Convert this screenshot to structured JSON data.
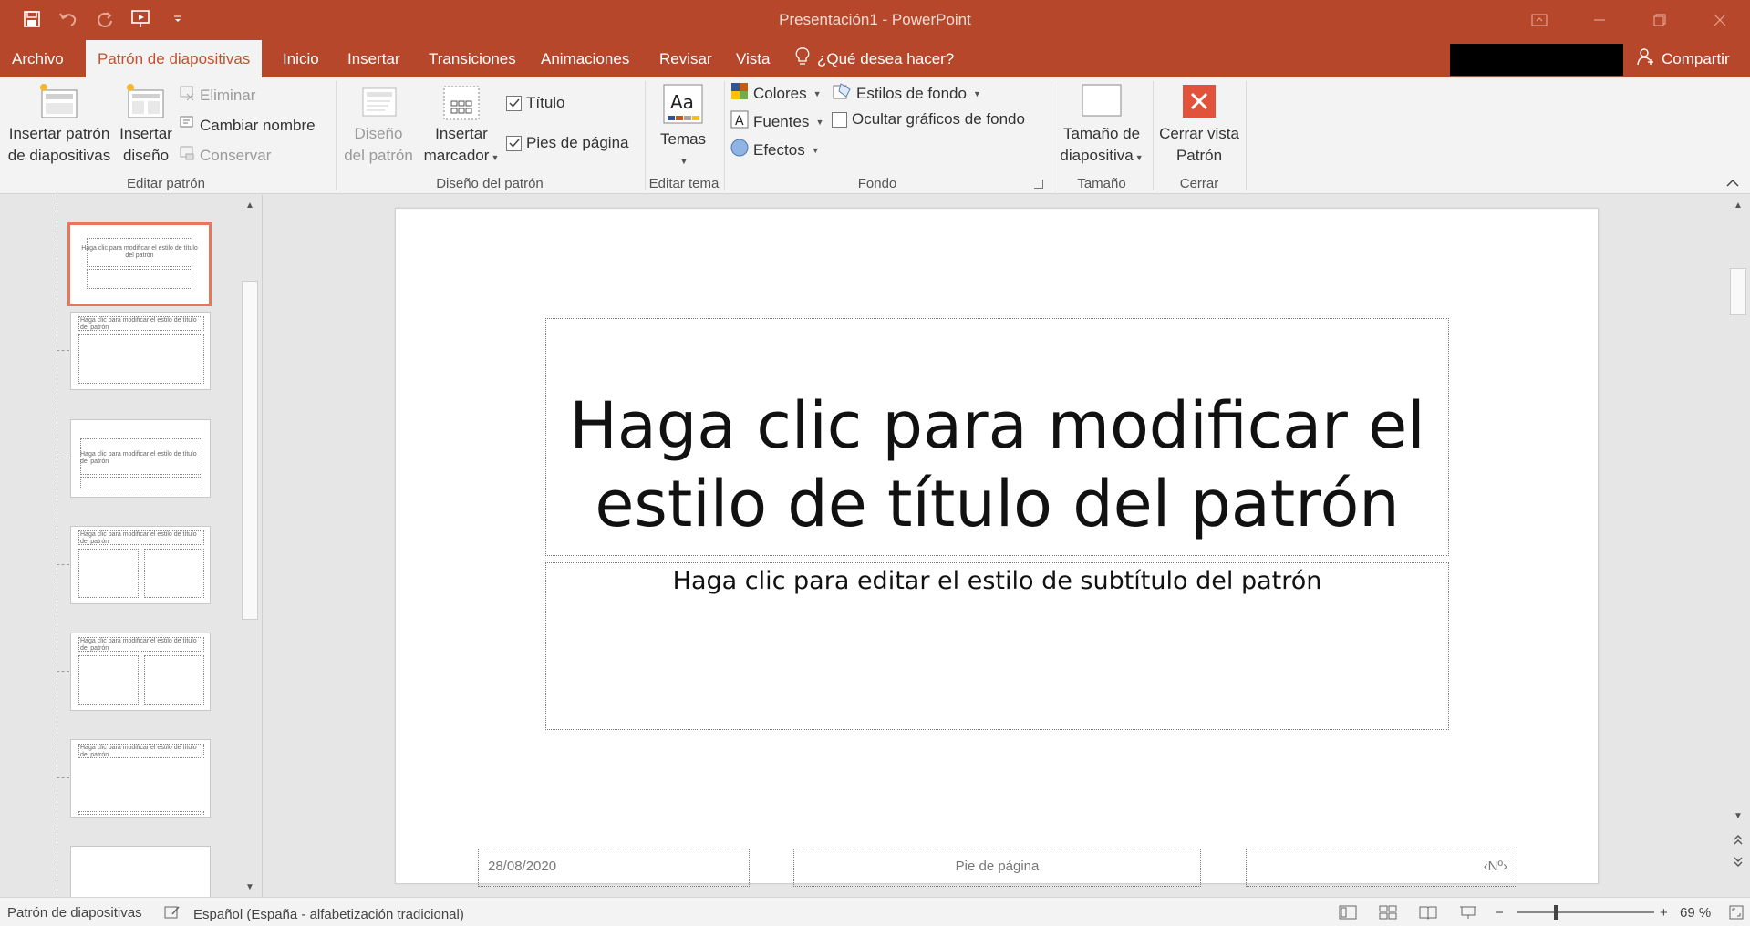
{
  "window": {
    "title": "Presentación1 - PowerPoint"
  },
  "quick_access": {
    "save_icon": "save-icon",
    "undo_icon": "undo-icon",
    "redo_icon": "redo-icon",
    "present_icon": "start-from-beginning-icon",
    "customize_icon": "customize-qat-icon"
  },
  "tabs": [
    {
      "label": "Archivo"
    },
    {
      "label": "Patrón de diapositivas",
      "active": true
    },
    {
      "label": "Inicio"
    },
    {
      "label": "Insertar"
    },
    {
      "label": "Transiciones"
    },
    {
      "label": "Animaciones"
    },
    {
      "label": "Revisar"
    },
    {
      "label": "Vista"
    }
  ],
  "tell_me": "¿Qué desea hacer?",
  "share_label": "Compartir",
  "ribbon": {
    "editar_patron": {
      "label": "Editar patrón",
      "insert_master": [
        "Insertar patrón",
        "de diapositivas"
      ],
      "insert_layout": [
        "Insertar",
        "diseño"
      ],
      "delete": "Eliminar",
      "rename": "Cambiar nombre",
      "preserve": "Conservar"
    },
    "diseno_patron": {
      "label": "Diseño del patrón",
      "master_layout": [
        "Diseño",
        "del patrón"
      ],
      "insert_placeholder": [
        "Insertar",
        "marcador"
      ],
      "title_check": "Título",
      "footers_check": "Pies de página"
    },
    "editar_tema": {
      "label": "Editar tema",
      "themes": "Temas"
    },
    "fondo": {
      "label": "Fondo",
      "colors": "Colores",
      "fonts": "Fuentes",
      "effects": "Efectos",
      "bg_styles": "Estilos de fondo",
      "hide_bg": "Ocultar gráficos de fondo"
    },
    "tamano": {
      "label": "Tamaño",
      "slide_size": [
        "Tamaño de",
        "diapositiva"
      ]
    },
    "cerrar": {
      "label": "Cerrar",
      "close_master": [
        "Cerrar vista",
        "Patrón"
      ]
    }
  },
  "thumbnails": [
    {
      "text": "Haga clic para modificar el estilo de título del patrón",
      "selected": true
    },
    {
      "text": "Haga clic para modificar el estilo de título del patrón"
    },
    {
      "text": "Haga clic para modificar el estilo de título del patrón"
    },
    {
      "text": "Haga clic para modificar el estilo de título del patrón"
    },
    {
      "text": "Haga clic para modificar el estilo de título del patrón"
    },
    {
      "text": "Haga clic para modificar el estilo de título del patrón"
    },
    {
      "text": ""
    }
  ],
  "slide": {
    "title_line1": "Haga clic para modificar el",
    "title_line2": "estilo de título del patrón",
    "subtitle": "Haga clic para editar el estilo de subtítulo del patrón",
    "date": "28/08/2020",
    "footer": "Pie de página",
    "number": "‹Nº›"
  },
  "status": {
    "view": "Patrón de diapositivas",
    "language": "Español (España - alfabetización tradicional)",
    "zoom": "69 %",
    "zoom_minus": "−",
    "zoom_plus": "+"
  },
  "colors": {
    "accent": "#b7472a",
    "selected_thumb": "#e5785a"
  }
}
